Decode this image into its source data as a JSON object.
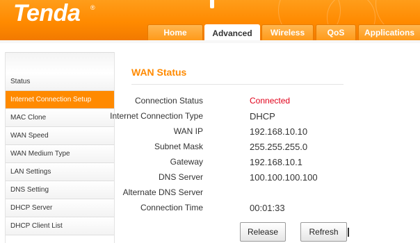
{
  "brand": {
    "logo_text": "Tenda",
    "reg_mark": "®"
  },
  "nav": {
    "tabs": [
      {
        "label": "Home",
        "active": false
      },
      {
        "label": "Advanced",
        "active": true
      },
      {
        "label": "Wireless",
        "active": false
      },
      {
        "label": "QoS",
        "active": false
      },
      {
        "label": "Applications",
        "active": false
      }
    ]
  },
  "sidebar": {
    "items": [
      {
        "label": "Status",
        "active": false
      },
      {
        "label": "Internet Connection Setup",
        "active": true
      },
      {
        "label": "MAC Clone",
        "active": false
      },
      {
        "label": "WAN Speed",
        "active": false
      },
      {
        "label": "WAN Medium Type",
        "active": false
      },
      {
        "label": "LAN Settings",
        "active": false
      },
      {
        "label": "DNS Setting",
        "active": false
      },
      {
        "label": "DHCP Server",
        "active": false
      },
      {
        "label": "DHCP Client List",
        "active": false
      }
    ]
  },
  "wan_status": {
    "title": "WAN Status",
    "rows": [
      {
        "label": "Connection Status",
        "value": "Connected"
      },
      {
        "label": "Internet Connection Type",
        "value": "DHCP"
      },
      {
        "label": "WAN IP",
        "value": "192.168.10.10"
      },
      {
        "label": "Subnet Mask",
        "value": "255.255.255.0"
      },
      {
        "label": "Gateway",
        "value": "192.168.10.1"
      },
      {
        "label": "DNS Server",
        "value": "100.100.100.100"
      },
      {
        "label": "Alternate DNS Server",
        "value": ""
      },
      {
        "label": "Connection Time",
        "value": "00:01:33"
      }
    ],
    "release_label": "Release",
    "refresh_label": "Refresh"
  },
  "colors": {
    "brand_orange": "#ff8a00",
    "connected_red": "#e1001a"
  }
}
